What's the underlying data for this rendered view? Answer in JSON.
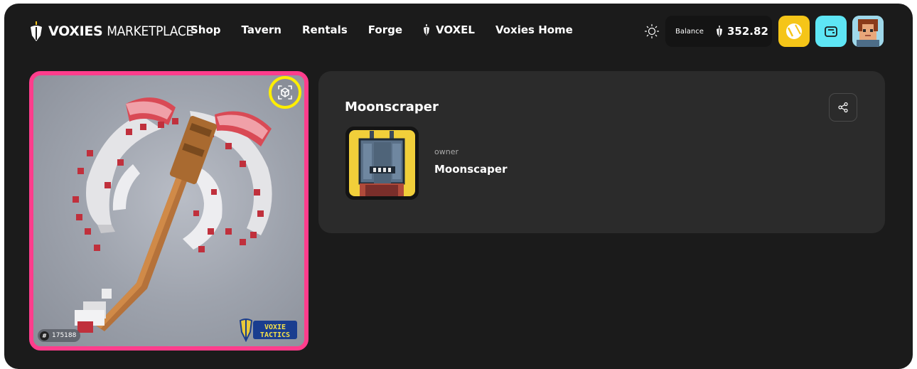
{
  "header": {
    "logo_bold": "VOXIES",
    "logo_thin": "MARKETPLACE",
    "nav": [
      {
        "label": "Shop"
      },
      {
        "label": "Tavern"
      },
      {
        "label": "Rentals"
      },
      {
        "label": "Forge"
      },
      {
        "label": "VOXEL",
        "icon": "voxel-coin-icon"
      },
      {
        "label": "Voxies Home"
      }
    ],
    "theme_icon": "sun-icon",
    "balance_label": "Balance",
    "balance_value": "352.82",
    "buttons": [
      {
        "name": "rewards-button",
        "icon": "coin-icon",
        "color": "#f5c518"
      },
      {
        "name": "wallet-button",
        "icon": "wallet-icon",
        "color": "#5ee6f5"
      },
      {
        "name": "profile-avatar-button",
        "icon": "avatar"
      }
    ]
  },
  "item": {
    "token_id": "175188",
    "token_hash": "#",
    "ar_button_icon": "3d-view-icon",
    "brand_watermark": "VOXIE TACTICS",
    "accent_color": "#ff3d8c",
    "highlight_color": "#ffee00"
  },
  "details": {
    "title": "Moonscraper",
    "owner_label": "owner",
    "owner_name": "Moonscaper",
    "share_icon": "share-icon"
  }
}
